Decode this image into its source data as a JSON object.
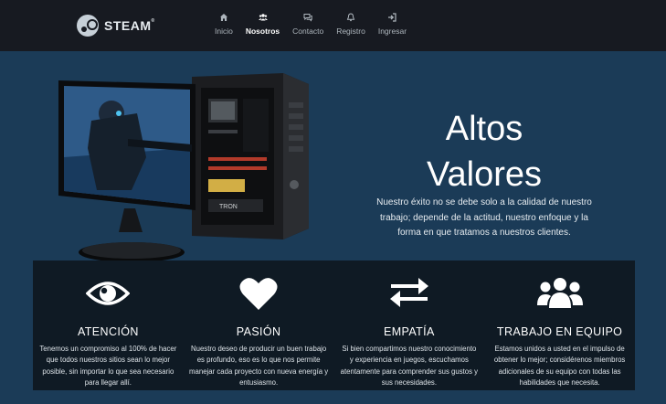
{
  "brand": {
    "name": "STEAM",
    "trademark": "®",
    "icon": "steam-logo-icon"
  },
  "nav": [
    {
      "label": "Inicio",
      "icon": "home-icon",
      "active": false
    },
    {
      "label": "Nosotros",
      "icon": "users-icon",
      "active": true
    },
    {
      "label": "Contacto",
      "icon": "chat-icon",
      "active": false
    },
    {
      "label": "Registro",
      "icon": "bell-icon",
      "active": false
    },
    {
      "label": "Ingresar",
      "icon": "sign-in-icon",
      "active": false
    }
  ],
  "hero": {
    "title_line1": "Altos",
    "title_line2": "Valores",
    "text": "Nuestro éxito no se debe solo a la calidad de nuestro trabajo; depende de la actitud, nuestro enfoque y la forma en que tratamos a nuestros clientes."
  },
  "features": [
    {
      "title": "ATENCIÓN",
      "icon": "eye-icon",
      "text": "Tenemos un compromiso al 100% de hacer que todos nuestros sitios sean lo mejor posible, sin importar lo que sea necesario para llegar allí."
    },
    {
      "title": "PASIÓN",
      "icon": "heart-icon",
      "text": "Nuestro deseo de producir un buen trabajo es profundo, eso es lo que nos permite manejar cada proyecto con nueva energía y entusiasmo."
    },
    {
      "title": "EMPATÍA",
      "icon": "exchange-icon",
      "text": "Si bien compartimos nuestro conocimiento y experiencia en juegos, escuchamos atentamente para comprender sus gustos y sus necesidades."
    },
    {
      "title": "TRABAJO EN EQUIPO",
      "icon": "team-icon",
      "text": "Estamos unidos a usted en el impulso de obtener lo mejor; considérenos miembros adicionales de su equipo con todas las habilidades que necesita."
    }
  ],
  "colors": {
    "navbar": "#171a21",
    "hero_bg": "#1b3b57",
    "features_bg": "#0f1a24",
    "text": "#ffffff"
  }
}
